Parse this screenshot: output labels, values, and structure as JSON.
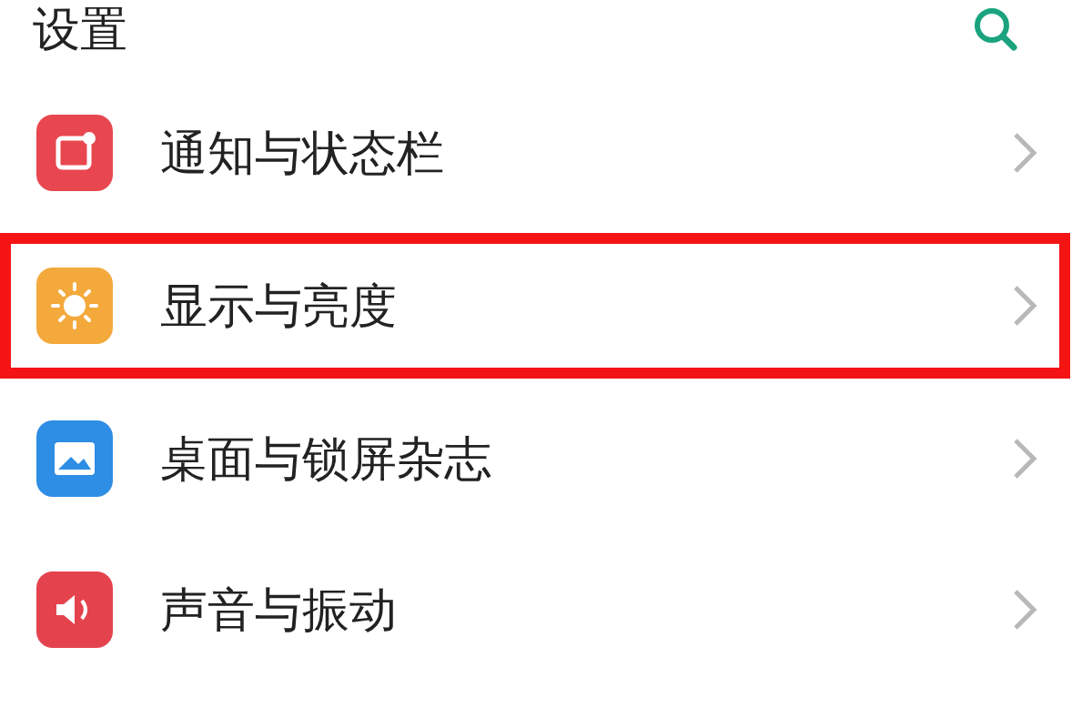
{
  "header": {
    "title": "设置"
  },
  "items": [
    {
      "label": "通知与状态栏",
      "kind": "notification",
      "color": "#e8474f",
      "highlighted": false
    },
    {
      "label": "显示与亮度",
      "kind": "display",
      "color": "#f3a93b",
      "highlighted": true
    },
    {
      "label": "桌面与锁屏杂志",
      "kind": "desktop",
      "color": "#2e8de4",
      "highlighted": false
    },
    {
      "label": "声音与振动",
      "kind": "sound",
      "color": "#e4434e",
      "highlighted": false
    }
  ]
}
